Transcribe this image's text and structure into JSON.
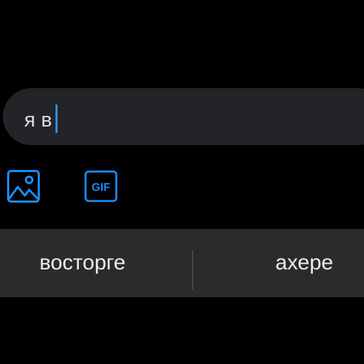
{
  "composer": {
    "text": "я в",
    "caret_color": "#2e8fff"
  },
  "attachments": [
    {
      "icon": "image-icon"
    },
    {
      "icon": "gif-icon",
      "label": "GIF"
    }
  ],
  "keyboard": {
    "suggestions": [
      "восторге",
      "ахере"
    ]
  },
  "colors": {
    "accent": "#1d8cf8",
    "input_background": "#222427",
    "suggestion_bar": "#2b2b2b"
  }
}
